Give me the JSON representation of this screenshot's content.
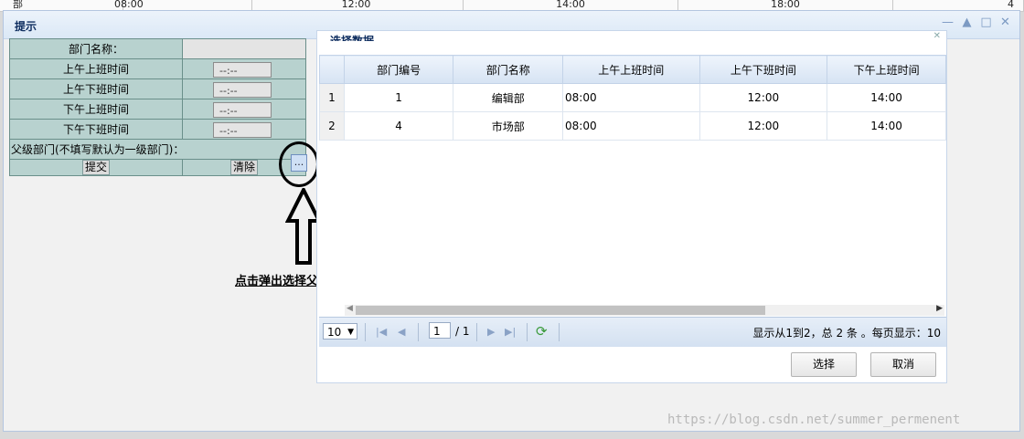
{
  "background": {
    "cells": [
      "部",
      "08:00",
      "12:00",
      "14:00",
      "18:00",
      "4"
    ]
  },
  "window": {
    "title": "提示",
    "tools": [
      "—",
      "▲",
      "□",
      "✕"
    ]
  },
  "form": {
    "dept_name_label": "部门名称：",
    "am_on_label": "上午上班时间",
    "am_off_label": "上午下班时间",
    "pm_on_label": "下午上班时间",
    "pm_off_label": "下午下班时间",
    "time_placeholder": "--:--",
    "parent_label": "父级部门(不填写默认为一级部门)：",
    "parent_button": "...",
    "submit_label": "提交",
    "clear_label": "清除"
  },
  "annotation": {
    "text": "点击弹出选择父级部门框"
  },
  "dialog": {
    "title": "选择数据",
    "columns": [
      "部门编号",
      "部门名称",
      "上午上班时间",
      "上午下班时间",
      "下午上班时间"
    ],
    "rows": [
      {
        "index": "1",
        "id": "1",
        "name": "编辑部",
        "am_on": "08:00",
        "am_off": "12:00",
        "pm_on": "14:00"
      },
      {
        "index": "2",
        "id": "4",
        "name": "市场部",
        "am_on": "08:00",
        "am_off": "12:00",
        "pm_on": "14:00"
      }
    ],
    "pager": {
      "page_size": "10",
      "current_page": "1",
      "total_pages": "/ 1",
      "info": "显示从1到2，总 2 条 。每页显示：10"
    },
    "select_button": "选择",
    "cancel_button": "取消"
  },
  "watermark": "https://blog.csdn.net/summer_permenent",
  "colors": {
    "form_cell": "#b8d2cf",
    "header_gradient": "#dbe8f6",
    "pager_bg": "#d4e1f1"
  }
}
